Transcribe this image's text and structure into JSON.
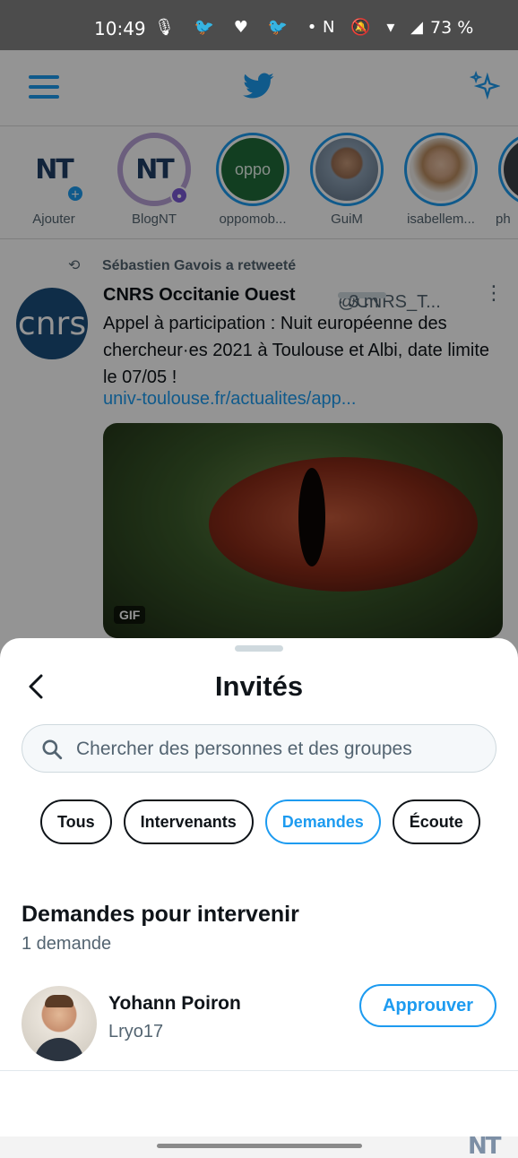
{
  "status_bar": {
    "time": "10:49",
    "left_icons": "🎙 🐦 ♥ 🐦 •",
    "right_icons": "N 🔕 ▾ ◢",
    "battery": "73 %"
  },
  "app": {
    "fleets": [
      {
        "label": "Ajouter",
        "avatar_text": "NT"
      },
      {
        "label": "BlogNT",
        "avatar_text": "NT"
      },
      {
        "label": "oppomob...",
        "avatar_text": "oppo"
      },
      {
        "label": "GuiM",
        "avatar_text": ""
      },
      {
        "label": "isabellem...",
        "avatar_text": ""
      },
      {
        "label": "ph",
        "avatar_text": ""
      }
    ],
    "tweet": {
      "retweet_text": "Sébastien Gavois a retweeté",
      "avatar_text": "cnrs",
      "author": "CNRS Occitanie Ouest",
      "handle": "@CNRS_T...",
      "time": "· 3 m",
      "text": "Appel à participation : Nuit européenne des chercheur·es 2021 à Toulouse et Albi, date limite le 07/05 !",
      "link": "univ-toulouse.fr/actualites/app...",
      "media_badge": "GIF"
    }
  },
  "sheet": {
    "title": "Invités",
    "search_placeholder": "Chercher des personnes et des groupes",
    "filters": [
      {
        "label": "Tous",
        "active": false
      },
      {
        "label": "Intervenants",
        "active": false
      },
      {
        "label": "Demandes",
        "active": true
      },
      {
        "label": "Écoute",
        "active": false
      }
    ],
    "section_title": "Demandes pour intervenir",
    "section_count": "1 demande",
    "requests": [
      {
        "name": "Yohann Poiron",
        "handle": "Lryo17",
        "action_label": "Approuver"
      }
    ],
    "watermark": "NT"
  },
  "colors": {
    "accent": "#1d9bf0",
    "text_primary": "#0f1419",
    "text_secondary": "#536471",
    "scrim": "rgba(0,0,0,0.42)"
  }
}
